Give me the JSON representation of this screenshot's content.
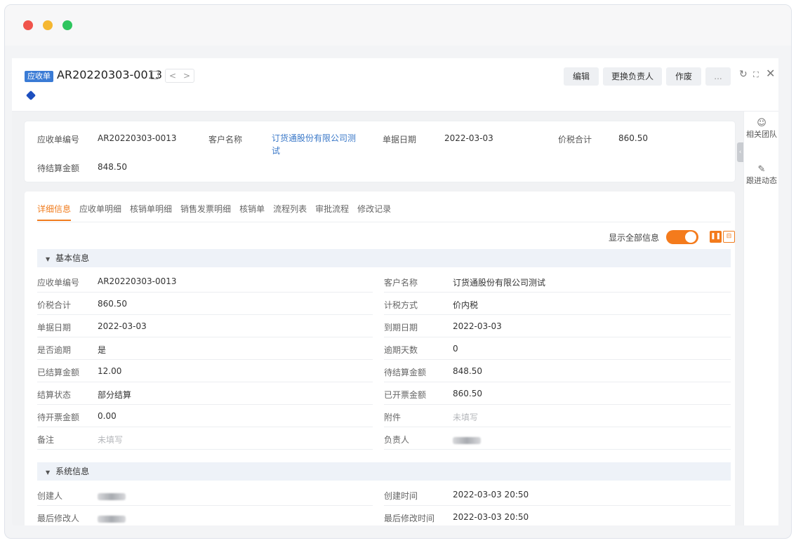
{
  "header": {
    "tag": "应收单",
    "doc_no": "AR20220303-0013",
    "prev": "<",
    "next": ">",
    "buttons": {
      "edit": "编辑",
      "change_owner": "更换负责人",
      "void": "作废",
      "more": "..."
    }
  },
  "sidebar": {
    "items": [
      {
        "label": "相关团队",
        "icon": "team-icon"
      },
      {
        "label": "跟进动态",
        "icon": "follow-icon"
      }
    ]
  },
  "summary": {
    "fields": [
      {
        "label": "应收单编号",
        "value": "AR20220303-0013"
      },
      {
        "label": "客户名称",
        "value": "订货通股份有限公司测试"
      },
      {
        "label": "单据日期",
        "value": "2022-03-03"
      },
      {
        "label": "价税合计",
        "value": "860.50"
      },
      {
        "label": "待结算金额",
        "value": "848.50"
      }
    ]
  },
  "tabs": [
    "详细信息",
    "应收单明细",
    "核销单明细",
    "销售发票明细",
    "核销单",
    "流程列表",
    "审批流程",
    "修改记录"
  ],
  "toolbar": {
    "show_all": "显示全部信息"
  },
  "basic": {
    "title": "基本信息",
    "rows": [
      [
        {
          "label": "应收单编号",
          "value": "AR20220303-0013"
        },
        {
          "label": "客户名称",
          "value": "订货通股份有限公司测试"
        }
      ],
      [
        {
          "label": "价税合计",
          "value": "860.50"
        },
        {
          "label": "计税方式",
          "value": "价内税"
        }
      ],
      [
        {
          "label": "单据日期",
          "value": "2022-03-03"
        },
        {
          "label": "到期日期",
          "value": "2022-03-03"
        }
      ],
      [
        {
          "label": "是否逾期",
          "value": "是"
        },
        {
          "label": "逾期天数",
          "value": "0"
        }
      ],
      [
        {
          "label": "已结算金额",
          "value": "12.00"
        },
        {
          "label": "待结算金额",
          "value": "848.50"
        }
      ],
      [
        {
          "label": "结算状态",
          "value": "部分结算"
        },
        {
          "label": "已开票金额",
          "value": "860.50"
        }
      ],
      [
        {
          "label": "待开票金额",
          "value": "0.00"
        },
        {
          "label": "附件",
          "value": "未填写"
        }
      ],
      [
        {
          "label": "备注",
          "value": "未填写"
        },
        {
          "label": "负责人",
          "value": ""
        }
      ]
    ]
  },
  "system": {
    "title": "系统信息",
    "rows": [
      [
        {
          "label": "创建人",
          "value": ""
        },
        {
          "label": "创建时间",
          "value": "2022-03-03 20:50"
        }
      ],
      [
        {
          "label": "最后修改人",
          "value": ""
        },
        {
          "label": "最后修改时间",
          "value": "2022-03-03 20:50"
        }
      ]
    ]
  },
  "colors": {
    "accent": "#f47b1c",
    "link": "#3a78c8",
    "tag": "#3a7bd5"
  }
}
